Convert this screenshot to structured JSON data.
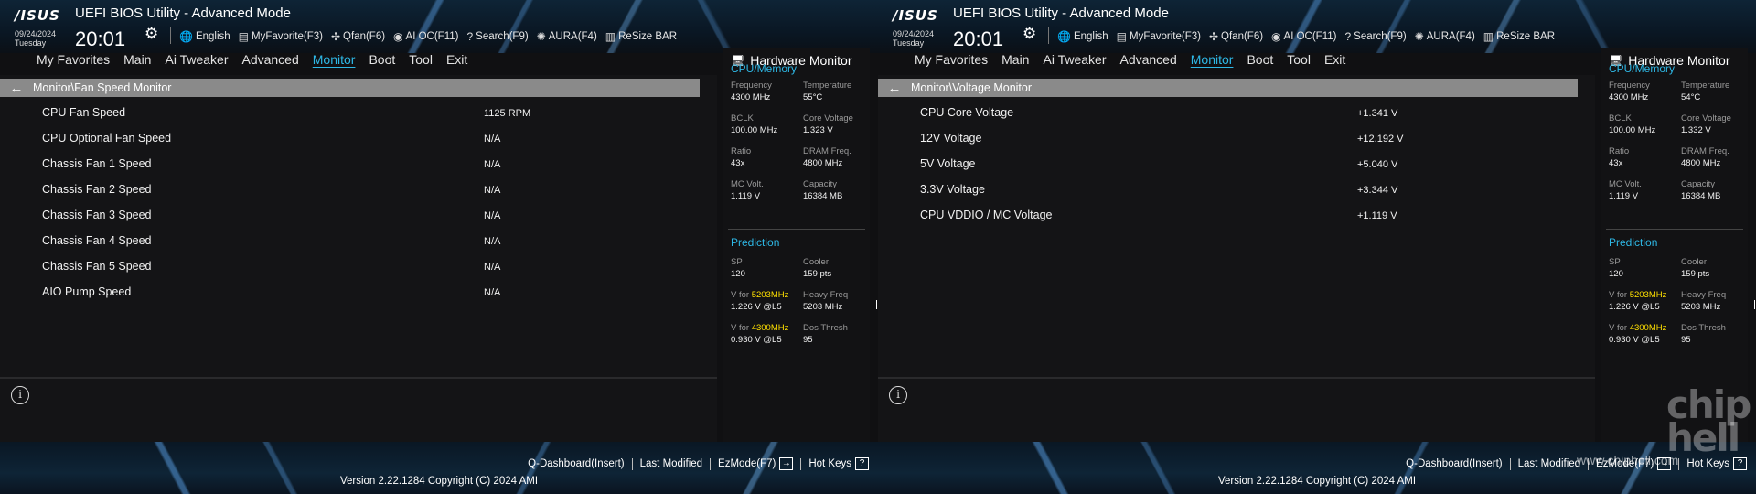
{
  "screens": [
    {
      "header": {
        "logo": "/ISUS",
        "title": "UEFI BIOS Utility - Advanced Mode",
        "date": "09/24/2024",
        "day": "Tuesday",
        "time": "20:01",
        "tools": [
          "English",
          "MyFavorite(F3)",
          "Qfan(F6)",
          "AI OC(F11)",
          "Search(F9)",
          "AURA(F4)",
          "ReSize BAR"
        ]
      },
      "menu": [
        "My Favorites",
        "Main",
        "Ai Tweaker",
        "Advanced",
        "Monitor",
        "Boot",
        "Tool",
        "Exit"
      ],
      "active_menu": "Monitor",
      "breadcrumb": "Monitor\\Fan Speed Monitor",
      "rows": [
        {
          "label": "CPU Fan Speed",
          "value": "1125 RPM"
        },
        {
          "label": "CPU Optional Fan Speed",
          "value": "N/A"
        },
        {
          "label": "Chassis Fan 1 Speed",
          "value": "N/A"
        },
        {
          "label": "Chassis Fan 2 Speed",
          "value": "N/A"
        },
        {
          "label": "Chassis Fan 3 Speed",
          "value": "N/A"
        },
        {
          "label": "Chassis Fan 4 Speed",
          "value": "N/A"
        },
        {
          "label": "Chassis Fan 5 Speed",
          "value": "N/A"
        },
        {
          "label": "AIO Pump Speed",
          "value": "N/A"
        }
      ],
      "hw": {
        "title": "Hardware Monitor",
        "cpu_title": "CPU/Memory",
        "cpu": [
          {
            "label": "Frequency",
            "value": "4300 MHz"
          },
          {
            "label": "Temperature",
            "value": "55°C"
          },
          {
            "label": "BCLK",
            "value": "100.00 MHz"
          },
          {
            "label": "Core Voltage",
            "value": "1.323 V"
          },
          {
            "label": "Ratio",
            "value": "43x"
          },
          {
            "label": "DRAM Freq.",
            "value": "4800 MHz"
          },
          {
            "label": "MC Volt.",
            "value": "1.119 V"
          },
          {
            "label": "Capacity",
            "value": "16384 MB"
          }
        ],
        "pred_title": "Prediction",
        "pred": [
          {
            "label": "SP",
            "value": "120"
          },
          {
            "label": "Cooler",
            "value": "159 pts"
          },
          {
            "label_pre": "V for ",
            "label_hl": "5203MHz",
            "value": "1.226 V @L5"
          },
          {
            "label": "Heavy Freq",
            "value": "5203 MHz"
          },
          {
            "label_pre": "V for ",
            "label_hl": "4300MHz",
            "value": "0.930 V @L5"
          },
          {
            "label": "Dos Thresh",
            "value": "95"
          }
        ]
      },
      "footer": {
        "links": [
          "Q-Dashboard(Insert)",
          "Last Modified",
          "EzMode(F7)",
          "Hot Keys"
        ],
        "copyright": "Version 2.22.1284 Copyright (C) 2024 AMI"
      }
    },
    {
      "header": {
        "logo": "/ISUS",
        "title": "UEFI BIOS Utility - Advanced Mode",
        "date": "09/24/2024",
        "day": "Tuesday",
        "time": "20:01",
        "tools": [
          "English",
          "MyFavorite(F3)",
          "Qfan(F6)",
          "AI OC(F11)",
          "Search(F9)",
          "AURA(F4)",
          "ReSize BAR"
        ]
      },
      "menu": [
        "My Favorites",
        "Main",
        "Ai Tweaker",
        "Advanced",
        "Monitor",
        "Boot",
        "Tool",
        "Exit"
      ],
      "active_menu": "Monitor",
      "breadcrumb": "Monitor\\Voltage Monitor",
      "rows": [
        {
          "label": "CPU Core Voltage",
          "value": "+1.341 V"
        },
        {
          "label": "12V Voltage",
          "value": "+12.192 V"
        },
        {
          "label": "5V Voltage",
          "value": "+5.040 V"
        },
        {
          "label": "3.3V Voltage",
          "value": "+3.344 V"
        },
        {
          "label": "CPU VDDIO / MC Voltage",
          "value": "+1.119 V"
        }
      ],
      "hw": {
        "title": "Hardware Monitor",
        "cpu_title": "CPU/Memory",
        "cpu": [
          {
            "label": "Frequency",
            "value": "4300 MHz"
          },
          {
            "label": "Temperature",
            "value": "54°C"
          },
          {
            "label": "BCLK",
            "value": "100.00 MHz"
          },
          {
            "label": "Core Voltage",
            "value": "1.332 V"
          },
          {
            "label": "Ratio",
            "value": "43x"
          },
          {
            "label": "DRAM Freq.",
            "value": "4800 MHz"
          },
          {
            "label": "MC Volt.",
            "value": "1.119 V"
          },
          {
            "label": "Capacity",
            "value": "16384 MB"
          }
        ],
        "pred_title": "Prediction",
        "pred": [
          {
            "label": "SP",
            "value": "120"
          },
          {
            "label": "Cooler",
            "value": "159 pts"
          },
          {
            "label_pre": "V for ",
            "label_hl": "5203MHz",
            "value": "1.226 V @L5"
          },
          {
            "label": "Heavy Freq",
            "value": "5203 MHz"
          },
          {
            "label_pre": "V for ",
            "label_hl": "4300MHz",
            "value": "0.930 V @L5"
          },
          {
            "label": "Dos Thresh",
            "value": "95"
          }
        ]
      },
      "footer": {
        "links": [
          "Q-Dashboard(Insert)",
          "Last Modified",
          "EzMode(F7)",
          "Hot Keys"
        ],
        "copyright": "Version 2.22.1284 Copyright (C) 2024 AMI"
      }
    }
  ],
  "watermark": {
    "logo": "chip hell",
    "url": "www.chiphell.com"
  },
  "colors": {
    "accent": "#2eb8e6",
    "highlight": "#ffe000",
    "breadcrumb_bar": "#8a8a8a",
    "panel_bg": "#141416"
  }
}
